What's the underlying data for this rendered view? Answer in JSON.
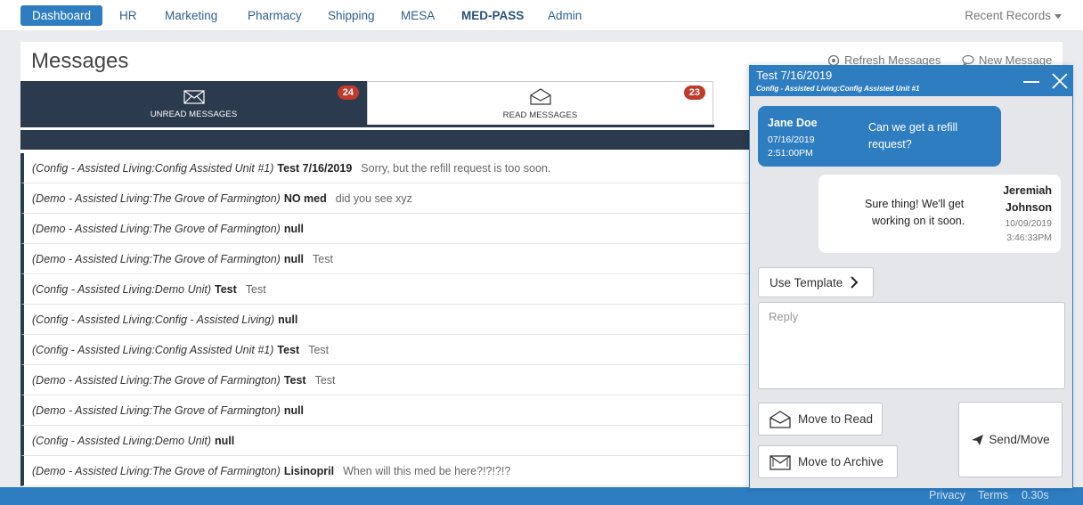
{
  "nav": {
    "items": [
      {
        "label": "Dashboard"
      },
      {
        "label": "HR"
      },
      {
        "label": "Marketing"
      },
      {
        "label": "Pharmacy"
      },
      {
        "label": "Shipping"
      },
      {
        "label": "MESA"
      },
      {
        "label": "MED-PASS"
      },
      {
        "label": "Admin"
      }
    ],
    "recent_records": "Recent Records"
  },
  "page": {
    "title": "Messages",
    "refresh_label": "Refresh Messages",
    "new_label": "New Message"
  },
  "tabs": [
    {
      "label": "UNREAD MESSAGES",
      "count": "24"
    },
    {
      "label": "READ MESSAGES",
      "count": "23"
    }
  ],
  "messages": [
    {
      "location": "(Config - Assisted Living:Config Assisted Unit #1)",
      "subject": "Test 7/16/2019",
      "preview": "Sorry, but the refill request is too soon."
    },
    {
      "location": "(Demo - Assisted Living:The Grove of Farmington)",
      "subject": "NO med",
      "preview": "did you see xyz"
    },
    {
      "location": "(Demo - Assisted Living:The Grove of Farmington)",
      "subject": "null",
      "preview": ""
    },
    {
      "location": "(Demo - Assisted Living:The Grove of Farmington)",
      "subject": "null",
      "preview": "Test"
    },
    {
      "location": "(Config - Assisted Living:Demo Unit)",
      "subject": "Test",
      "preview": "Test"
    },
    {
      "location": "(Config - Assisted Living:Config - Assisted Living)",
      "subject": "null",
      "preview": ""
    },
    {
      "location": "(Config - Assisted Living:Config Assisted Unit #1)",
      "subject": "Test",
      "preview": "Test"
    },
    {
      "location": "(Demo - Assisted Living:The Grove of Farmington)",
      "subject": "Test",
      "preview": "Test"
    },
    {
      "location": "(Demo - Assisted Living:The Grove of Farmington)",
      "subject": "null",
      "preview": ""
    },
    {
      "location": "(Config - Assisted Living:Demo Unit)",
      "subject": "null",
      "preview": ""
    },
    {
      "location": "(Demo - Assisted Living:The Grove of Farmington)",
      "subject": "Lisinopril",
      "preview": "When will this med be here?!?!?!?"
    }
  ],
  "chat": {
    "title": "Test 7/16/2019",
    "subtitle": "Config - Assisted Living:Config Assisted Unit #1",
    "incoming": {
      "name": "Jane Doe",
      "date": "07/16/2019",
      "time": "2:51:00PM",
      "text_line1": "Can we get a refill",
      "text_line2": "request?"
    },
    "outgoing": {
      "name_line1": "Jeremiah",
      "name_line2": "Johnson",
      "date": "10/09/2019",
      "time": "3:46:33PM",
      "text_line1": "Sure thing! We'll get",
      "text_line2": "working on it soon."
    },
    "use_template": "Use Template",
    "reply_placeholder": "Reply",
    "move_read": "Move to Read",
    "move_archive": "Move to Archive",
    "send_move": "Send/Move"
  },
  "footer": {
    "privacy": "Privacy",
    "terms": "Terms",
    "timing": "0.30s"
  },
  "colors": {
    "brand_blue": "#2e7dc0",
    "dark_navy": "#2b3a4d",
    "badge_red": "#c0392b"
  }
}
